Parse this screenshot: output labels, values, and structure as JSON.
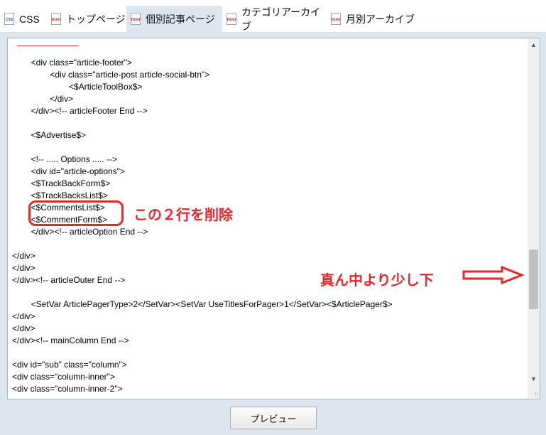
{
  "tabs": [
    {
      "label": "CSS",
      "icon": "css-file-icon",
      "icon_text": "CSS",
      "active": false
    },
    {
      "label": "トップページ",
      "icon": "html-file-icon",
      "icon_text": "html",
      "active": false
    },
    {
      "label": "個別記事ページ",
      "icon": "html-file-icon",
      "icon_text": "html",
      "active": true
    },
    {
      "label": "カテゴリアーカイブ",
      "icon": "html-file-icon",
      "icon_text": "html",
      "active": false
    },
    {
      "label": "月別アーカイブ",
      "icon": "html-file-icon",
      "icon_text": "html",
      "active": false
    }
  ],
  "editor": {
    "lines": [
      "        <div class=\"article-footer\">",
      "                <div class=\"article-post article-social-btn\">",
      "                        <$ArticleToolBox$>",
      "                </div>",
      "        </div><!-- articleFooter End -->",
      "",
      "        <$Advertise$>",
      "",
      "        <!-- ..... Options ..... -->",
      "        <div id=\"article-options\">",
      "        <$TrackBackForm$>",
      "        <$TrackBacksList$>",
      "        <$CommentsList$>",
      "        <$CommentForm$>",
      "        </div><!-- articleOption End -->",
      "",
      "</div>",
      "</div>",
      "</div><!-- articleOuter End -->",
      "",
      "        <SetVar ArticlePagerType>2</SetVar><SetVar UseTitlesForPager>1</SetVar><$ArticlePager$>",
      "</div>",
      "</div>",
      "</div><!-- mainColumn End -->",
      "",
      "<div id=\"sub\" class=\"column\">",
      "<div class=\"column-inner\">",
      "<div class=\"column-inner-2\">"
    ]
  },
  "annotations": {
    "delete_note": "この２行を削除",
    "scroll_note": "真ん中より少し下"
  },
  "colors": {
    "annotation_red": "#e8262c",
    "panel_bg": "#dde6ef"
  },
  "preview_button": {
    "label": "プレビュー"
  }
}
